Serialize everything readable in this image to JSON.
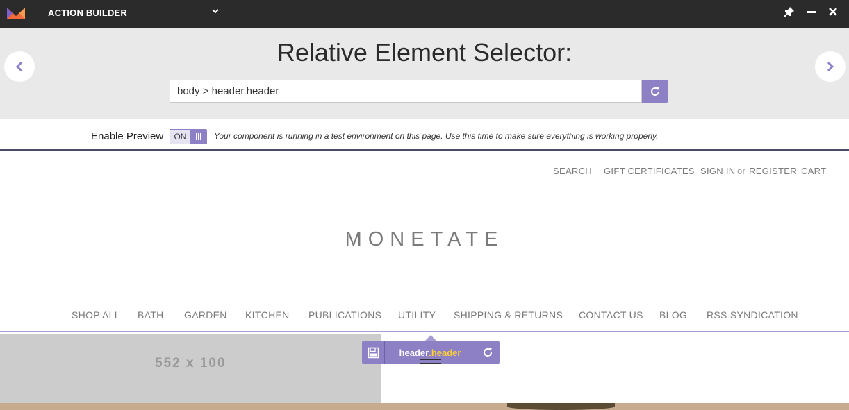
{
  "topbar": {
    "title": "ACTION BUILDER",
    "colors": {
      "background": "#2b2b2b",
      "logo_primary": "#f26b3a",
      "logo_secondary": "#7b5fd0"
    },
    "icons": [
      "monetate-logo-icon",
      "chevron-down-icon",
      "pin-icon",
      "minimize-icon",
      "close-icon"
    ]
  },
  "panel": {
    "title": "Relative Element Selector:",
    "selector_value": "body > header.header",
    "icons": [
      "arrow-left-icon",
      "arrow-right-icon",
      "refresh-icon"
    ]
  },
  "preview": {
    "label": "Enable Preview",
    "toggle_state": "ON",
    "note": "Your component is running in a test environment on this page. Use this time to make sure everything is working properly."
  },
  "site": {
    "utility_nav": {
      "search": "SEARCH",
      "gift": "GIFT CERTIFICATES",
      "signin": "SIGN IN",
      "or": "or",
      "register": "REGISTER",
      "cart": "CART"
    },
    "brand": "MONETATE",
    "main_nav": [
      "SHOP ALL",
      "BATH",
      "GARDEN",
      "KITCHEN",
      "PUBLICATIONS",
      "UTILITY",
      "SHIPPING & RETURNS",
      "CONTACT US",
      "BLOG",
      "RSS SYNDICATION"
    ],
    "placeholder": "552 x 100"
  },
  "element_tip": {
    "tag": "header",
    "dot": ".",
    "cls": "header",
    "icons": [
      "save-icon",
      "refresh-icon"
    ]
  },
  "accent_color": "#8e80c5"
}
